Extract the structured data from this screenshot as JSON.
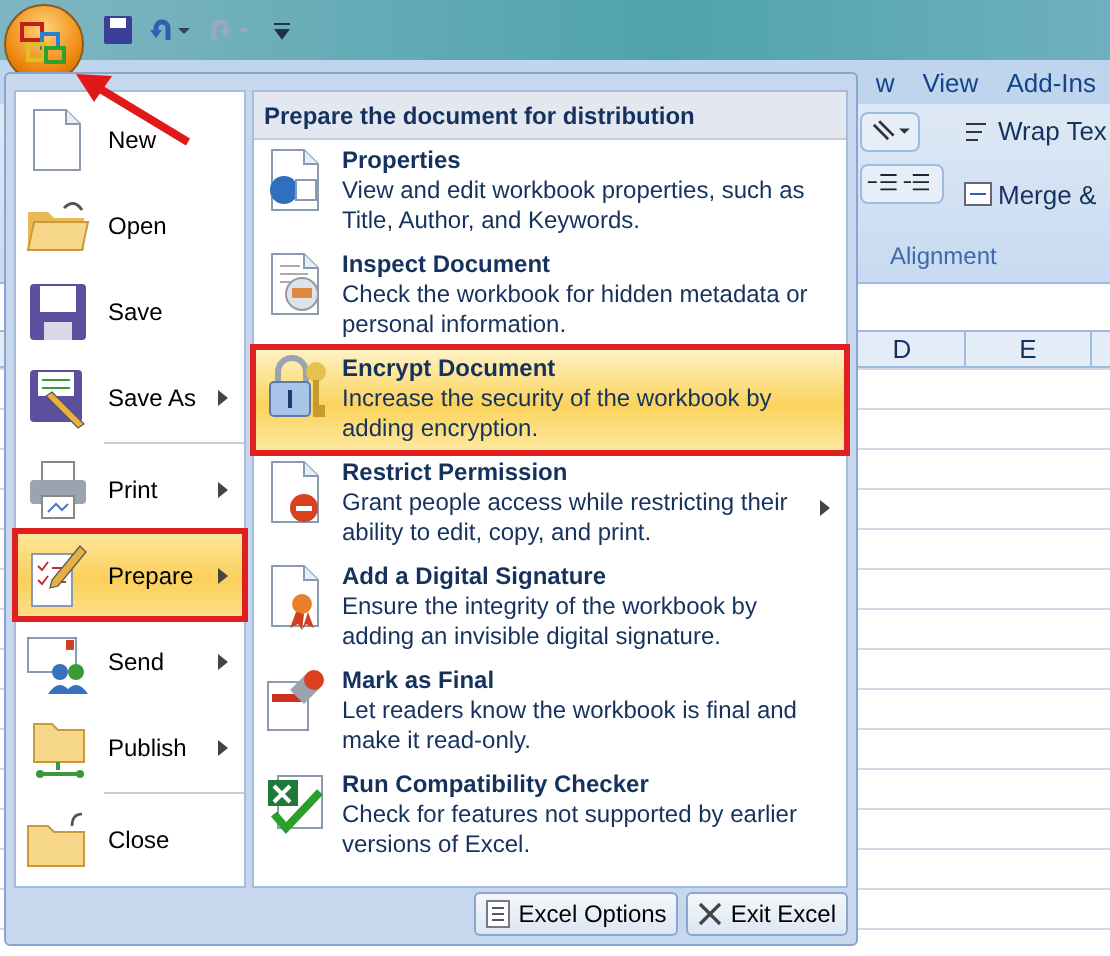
{
  "ribbon_tabs": [
    {
      "label": "w",
      "selected": false
    },
    {
      "label": "View",
      "selected": false
    },
    {
      "label": "Add-Ins",
      "selected": false
    }
  ],
  "ribbon": {
    "wrap_text": "Wrap Tex",
    "merge": "Merge &",
    "group_label": "Alignment"
  },
  "columns": [
    "D",
    "E"
  ],
  "office_menu": {
    "items": [
      {
        "label": "New",
        "has_submenu": false,
        "selected": false,
        "annotated": false
      },
      {
        "label": "Open",
        "has_submenu": false,
        "selected": false,
        "annotated": false
      },
      {
        "label": "Save",
        "has_submenu": false,
        "selected": false,
        "annotated": false
      },
      {
        "label": "Save As",
        "has_submenu": true,
        "selected": false,
        "annotated": false
      },
      {
        "label": "Print",
        "has_submenu": true,
        "selected": false,
        "annotated": false
      },
      {
        "label": "Prepare",
        "has_submenu": true,
        "selected": true,
        "annotated": true
      },
      {
        "label": "Send",
        "has_submenu": true,
        "selected": false,
        "annotated": false
      },
      {
        "label": "Publish",
        "has_submenu": true,
        "selected": false,
        "annotated": false
      },
      {
        "label": "Close",
        "has_submenu": false,
        "selected": false,
        "annotated": false
      }
    ],
    "submenu": {
      "title": "Prepare the document for distribution",
      "items": [
        {
          "title": "Properties",
          "description": "View and edit workbook properties, such as Title, Author, and Keywords.",
          "has_submenu": false,
          "selected": false,
          "annotated": false
        },
        {
          "title": "Inspect Document",
          "description": "Check the workbook for hidden metadata or personal information.",
          "has_submenu": false,
          "selected": false,
          "annotated": false
        },
        {
          "title": "Encrypt Document",
          "description": "Increase the security of the workbook by adding encryption.",
          "has_submenu": false,
          "selected": true,
          "annotated": true
        },
        {
          "title": "Restrict Permission",
          "description": "Grant people access while restricting their ability to edit, copy, and print.",
          "has_submenu": true,
          "selected": false,
          "annotated": false
        },
        {
          "title": "Add a Digital Signature",
          "description": "Ensure the integrity of the workbook by adding an invisible digital signature.",
          "has_submenu": false,
          "selected": false,
          "annotated": false
        },
        {
          "title": "Mark as Final",
          "description": "Let readers know the workbook is final and make it read-only.",
          "has_submenu": false,
          "selected": false,
          "annotated": false
        },
        {
          "title": "Run Compatibility Checker",
          "description": "Check for features not supported by earlier versions of Excel.",
          "has_submenu": false,
          "selected": false,
          "annotated": false
        }
      ]
    },
    "buttons": [
      {
        "label": "Excel Options",
        "kind": "options"
      },
      {
        "label": "Exit Excel",
        "kind": "exit"
      }
    ]
  }
}
